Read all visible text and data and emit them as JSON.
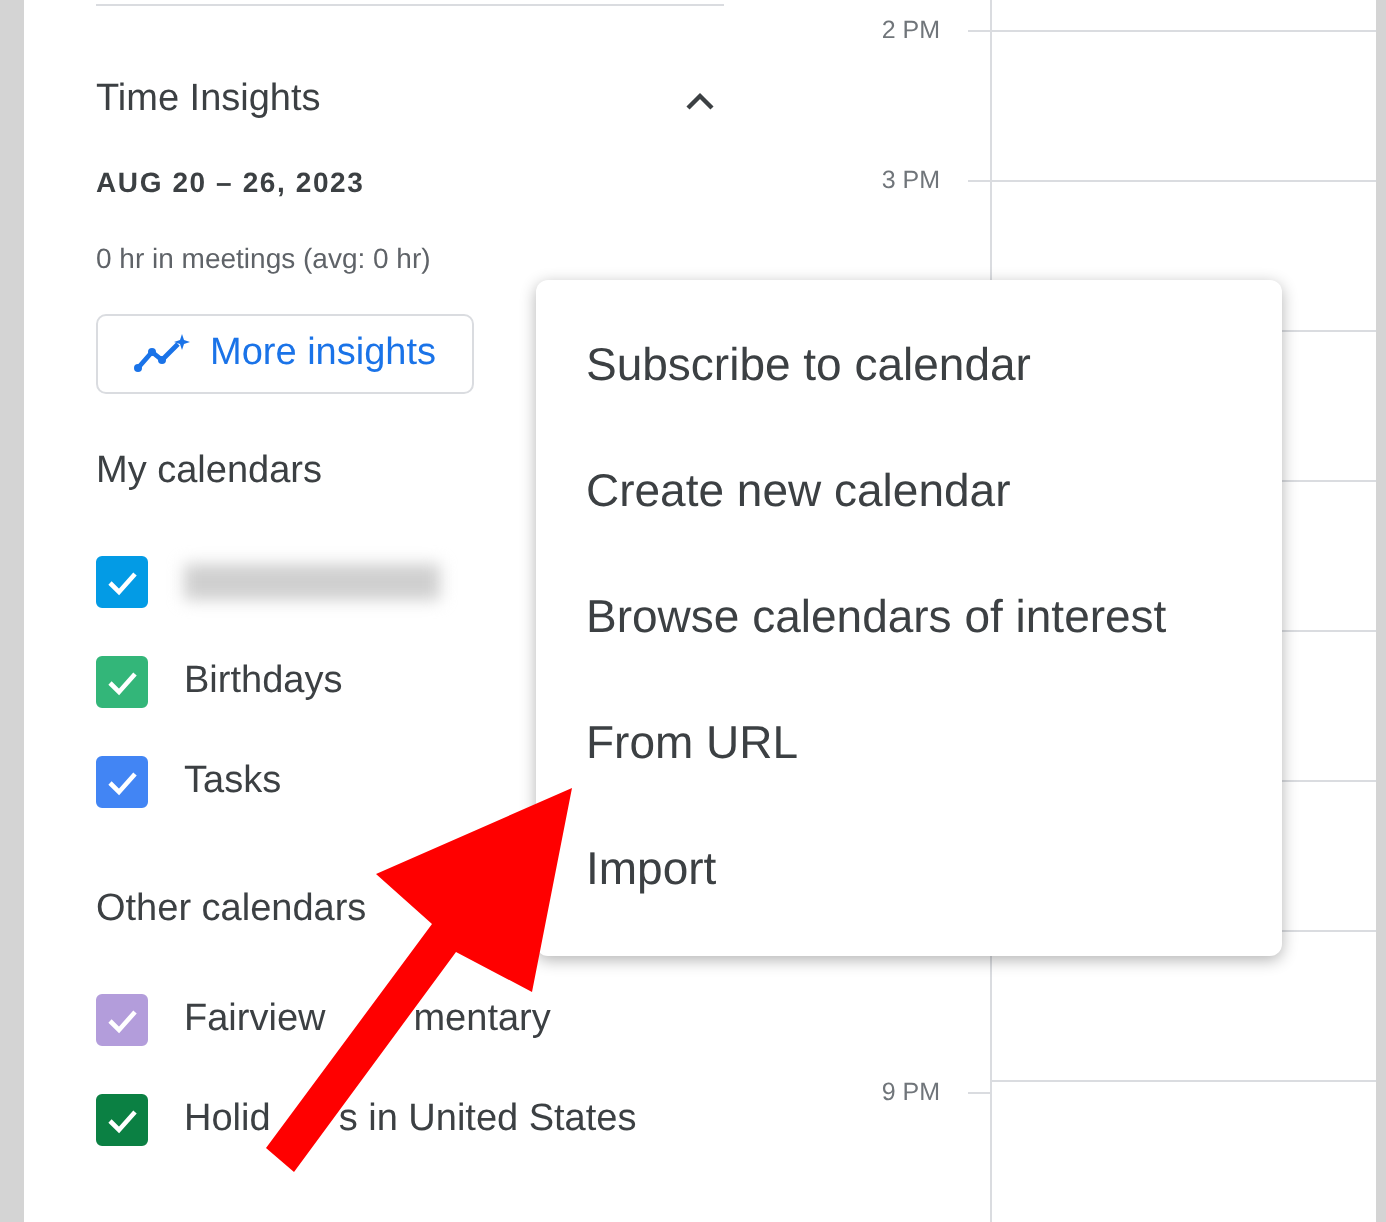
{
  "insights": {
    "title": "Time Insights",
    "expanded": true,
    "date_range": "AUG 20 – 26, 2023",
    "summary": "0 hr in meetings (avg: 0 hr)",
    "button": "More insights"
  },
  "my_calendars": {
    "title": "My calendars",
    "items": [
      {
        "kind": "redacted",
        "color": "#039be5",
        "checked": true
      },
      {
        "kind": "named",
        "label": "Birthdays",
        "color": "#33b679",
        "checked": true
      },
      {
        "kind": "named",
        "label": "Tasks",
        "color": "#4285f4",
        "checked": true
      }
    ]
  },
  "other_calendars": {
    "title": "Other calendars",
    "items": [
      {
        "kind": "covered",
        "label_parts": [
          "Fairview",
          "mentary"
        ],
        "color": "#b39ddb",
        "checked": true
      },
      {
        "kind": "covered",
        "label_parts": [
          "Holid",
          "s in United States"
        ],
        "color": "#0b8043",
        "checked": true
      }
    ]
  },
  "hour_labels": [
    "2 PM",
    "3 PM",
    "9 PM"
  ],
  "menu": {
    "items": [
      "Subscribe to calendar",
      "Create new calendar",
      "Browse calendars of interest",
      "From URL",
      "Import"
    ]
  },
  "annotation": {
    "kind": "arrow"
  }
}
